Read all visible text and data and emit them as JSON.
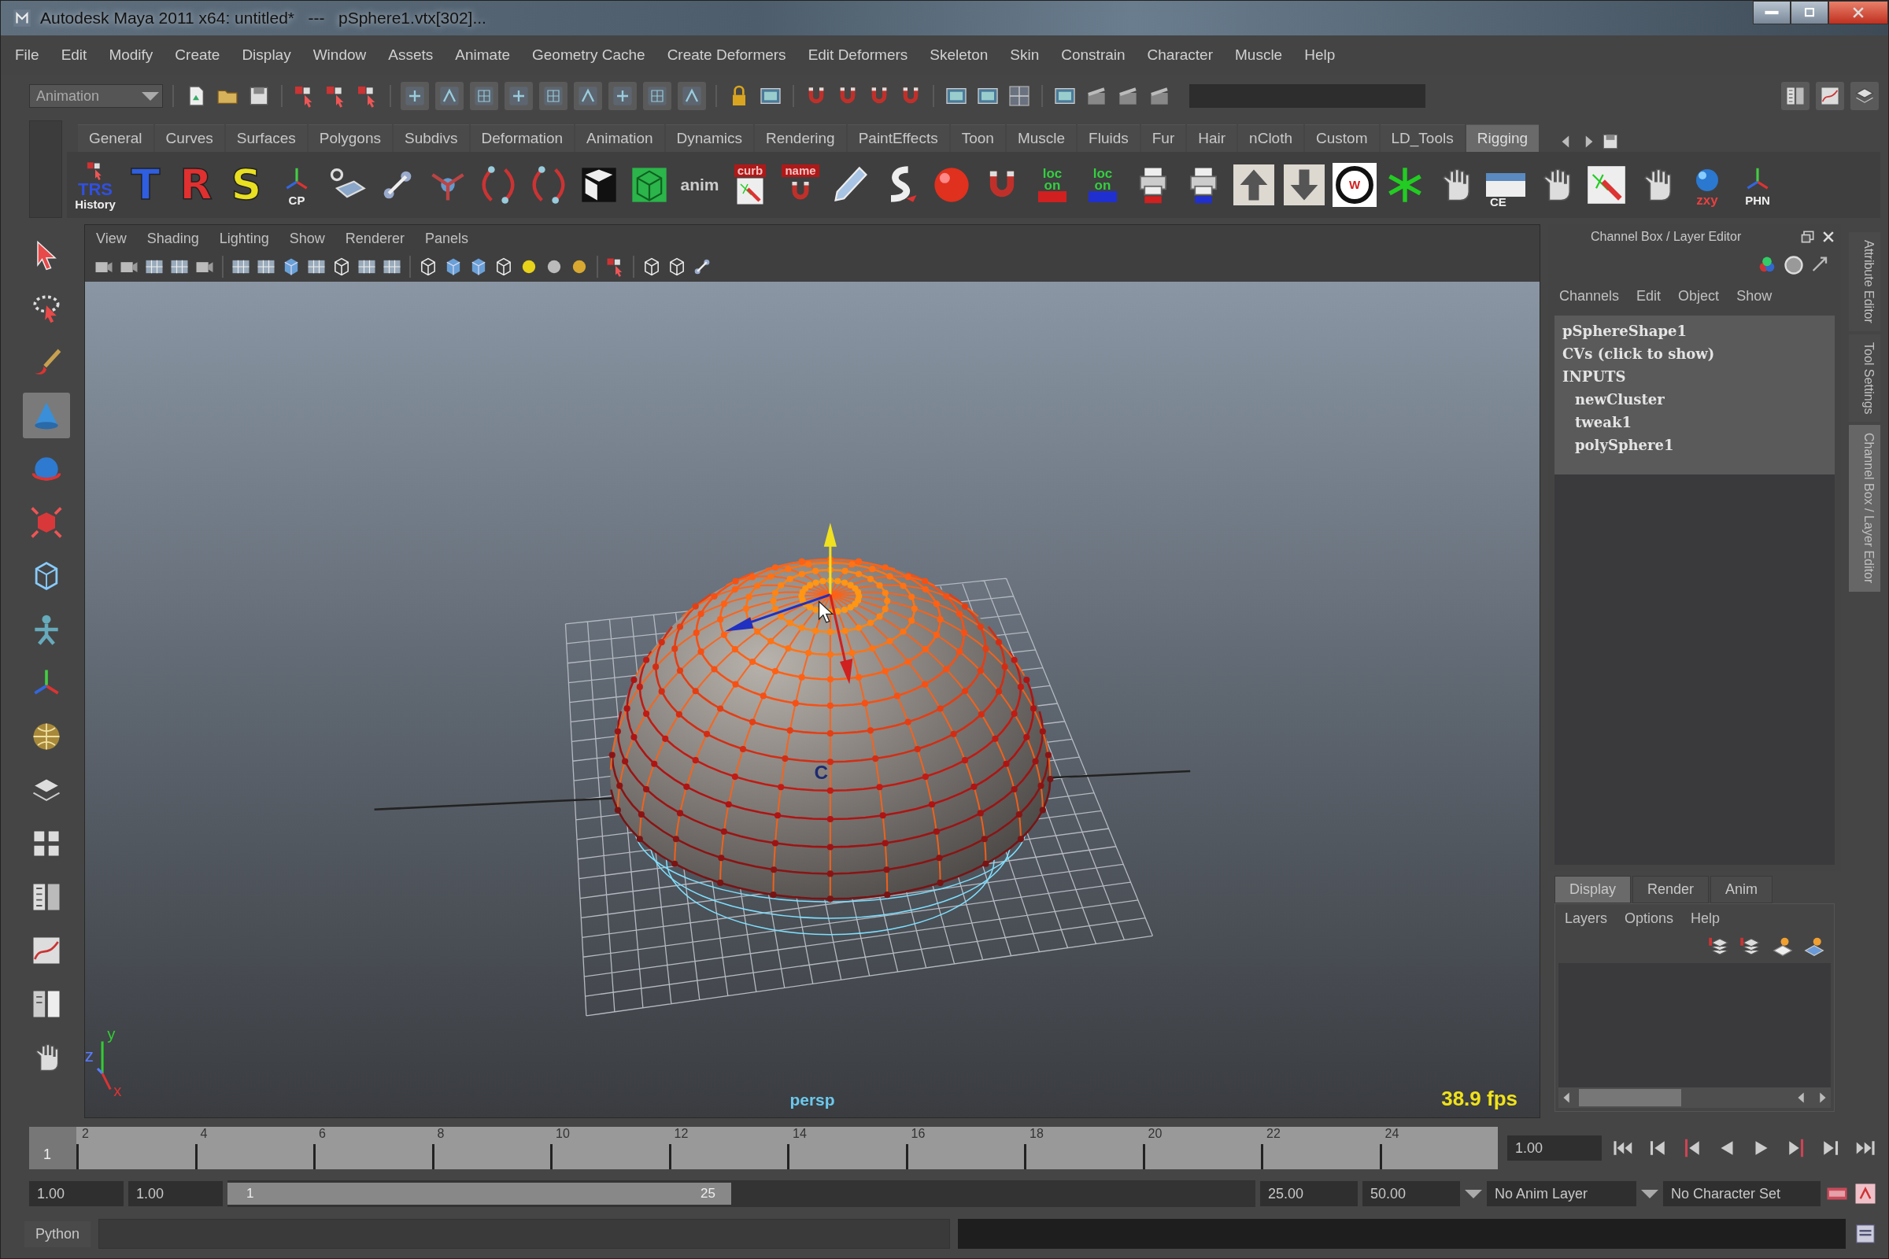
{
  "window": {
    "title": "Autodesk Maya 2011 x64: untitled*   ---   pSphere1.vtx[302]..."
  },
  "menu_bar": [
    "File",
    "Edit",
    "Modify",
    "Create",
    "Display",
    "Window",
    "Assets",
    "Animate",
    "Geometry Cache",
    "Create Deformers",
    "Edit Deformers",
    "Skeleton",
    "Skin",
    "Constrain",
    "Character",
    "Muscle",
    "Help"
  ],
  "status_line": {
    "mode": "Animation"
  },
  "shelf": {
    "tabs": [
      {
        "label": "General",
        "selected": false
      },
      {
        "label": "Curves",
        "selected": false
      },
      {
        "label": "Surfaces",
        "selected": false
      },
      {
        "label": "Polygons",
        "selected": false
      },
      {
        "label": "Subdivs",
        "selected": false
      },
      {
        "label": "Deformation",
        "selected": false
      },
      {
        "label": "Animation",
        "selected": false
      },
      {
        "label": "Dynamics",
        "selected": false
      },
      {
        "label": "Rendering",
        "selected": false
      },
      {
        "label": "PaintEffects",
        "selected": false
      },
      {
        "label": "Toon",
        "selected": false
      },
      {
        "label": "Muscle",
        "selected": false
      },
      {
        "label": "Fluids",
        "selected": false
      },
      {
        "label": "Fur",
        "selected": false
      },
      {
        "label": "Hair",
        "selected": false
      },
      {
        "label": "nCloth",
        "selected": false
      },
      {
        "label": "Custom",
        "selected": false
      },
      {
        "label": "LD_Tools",
        "selected": false
      },
      {
        "label": "Rigging",
        "selected": true
      }
    ],
    "items": [
      {
        "kind": "history",
        "label": "TRS",
        "caption": "History"
      },
      {
        "kind": "letter",
        "label": "T",
        "color": "#2f5fe0"
      },
      {
        "kind": "letter",
        "label": "R",
        "color": "#e03030"
      },
      {
        "kind": "letter",
        "label": "S",
        "color": "#e8e020"
      },
      {
        "kind": "axes",
        "label": "CP"
      },
      {
        "kind": "plane"
      },
      {
        "kind": "joint"
      },
      {
        "kind": "ik"
      },
      {
        "kind": "curve"
      },
      {
        "kind": "curve"
      },
      {
        "kind": "cube"
      },
      {
        "kind": "box"
      },
      {
        "kind": "text",
        "label": "anim"
      },
      {
        "kind": "badge",
        "label": "curb"
      },
      {
        "kind": "badge",
        "label": "name"
      },
      {
        "kind": "pencil"
      },
      {
        "kind": "swoosh"
      },
      {
        "kind": "ball"
      },
      {
        "kind": "magnet"
      },
      {
        "kind": "loc",
        "label": "loc on",
        "color": "#d02020"
      },
      {
        "kind": "loc",
        "label": "loc on",
        "color": "#2030d0"
      },
      {
        "kind": "printer",
        "color": "#d02020"
      },
      {
        "kind": "printer",
        "color": "#2030d0"
      },
      {
        "kind": "up"
      },
      {
        "kind": "down"
      },
      {
        "kind": "ring",
        "label": "W"
      },
      {
        "kind": "star"
      },
      {
        "kind": "hand"
      },
      {
        "kind": "window",
        "label": "CE"
      },
      {
        "kind": "hand"
      },
      {
        "kind": "paint"
      },
      {
        "kind": "hand"
      },
      {
        "kind": "sphere",
        "label": "zxy"
      },
      {
        "kind": "axes",
        "label": "PHN"
      }
    ]
  },
  "toolbox": [
    {
      "kind": "select",
      "selected": false
    },
    {
      "kind": "lasso",
      "selected": false
    },
    {
      "kind": "paint",
      "selected": false
    },
    {
      "kind": "move",
      "selected": true
    },
    {
      "kind": "rotate",
      "selected": false
    },
    {
      "kind": "scale",
      "selected": false
    },
    {
      "kind": "manip",
      "selected": false
    },
    {
      "kind": "figure",
      "selected": false
    },
    {
      "kind": "axes",
      "selected": false
    },
    {
      "kind": "globe",
      "selected": false
    },
    {
      "kind": "layer",
      "selected": false
    },
    {
      "kind": "four",
      "selected": false
    },
    {
      "kind": "outliner",
      "selected": false
    },
    {
      "kind": "graph",
      "selected": false
    },
    {
      "kind": "split",
      "selected": false
    },
    {
      "kind": "hand",
      "selected": false
    }
  ],
  "viewport": {
    "menus": [
      "View",
      "Shading",
      "Lighting",
      "Show",
      "Renderer",
      "Panels"
    ],
    "camera": "persp",
    "fps": "38.9 fps",
    "handle_label": "C",
    "axis_labels": [
      "y",
      "z",
      "x"
    ]
  },
  "channel_box": {
    "title": "Channel Box / Layer Editor",
    "menus": [
      "Channels",
      "Edit",
      "Object",
      "Show"
    ],
    "nodes": [
      {
        "label": "pSphereShape1"
      },
      {
        "label": "CVs (click to show)"
      },
      {
        "label": "INPUTS",
        "children": [
          {
            "label": "newCluster"
          },
          {
            "label": "tweak1"
          },
          {
            "label": "polySphere1"
          }
        ]
      }
    ]
  },
  "layer_editor": {
    "tabs": [
      {
        "label": "Display",
        "selected": true
      },
      {
        "label": "Render",
        "selected": false
      },
      {
        "label": "Anim",
        "selected": false
      }
    ],
    "menus": [
      "Layers",
      "Options",
      "Help"
    ]
  },
  "side_tabs": [
    {
      "label": "Attribute Editor",
      "selected": false
    },
    {
      "label": "Tool Settings",
      "selected": false
    },
    {
      "label": "Channel Box / Layer Editor",
      "selected": true
    }
  ],
  "time_slider": {
    "current_frame": "1",
    "level": 0,
    "frame_labels": [
      "2",
      "4",
      "6",
      "8",
      "10",
      "12",
      "14",
      "16",
      "18",
      "20",
      "22",
      "24"
    ],
    "current_time": "1.00"
  },
  "range_slider": {
    "level": 0.49,
    "start_time": "1.00",
    "playback_start": "1.00",
    "range_start": "1",
    "range_end": "25",
    "playback_end": "25.00",
    "end_time": "50.00",
    "anim_layer": "No Anim Layer",
    "character_set": "No Character Set"
  },
  "command_line": {
    "language": "Python"
  }
}
